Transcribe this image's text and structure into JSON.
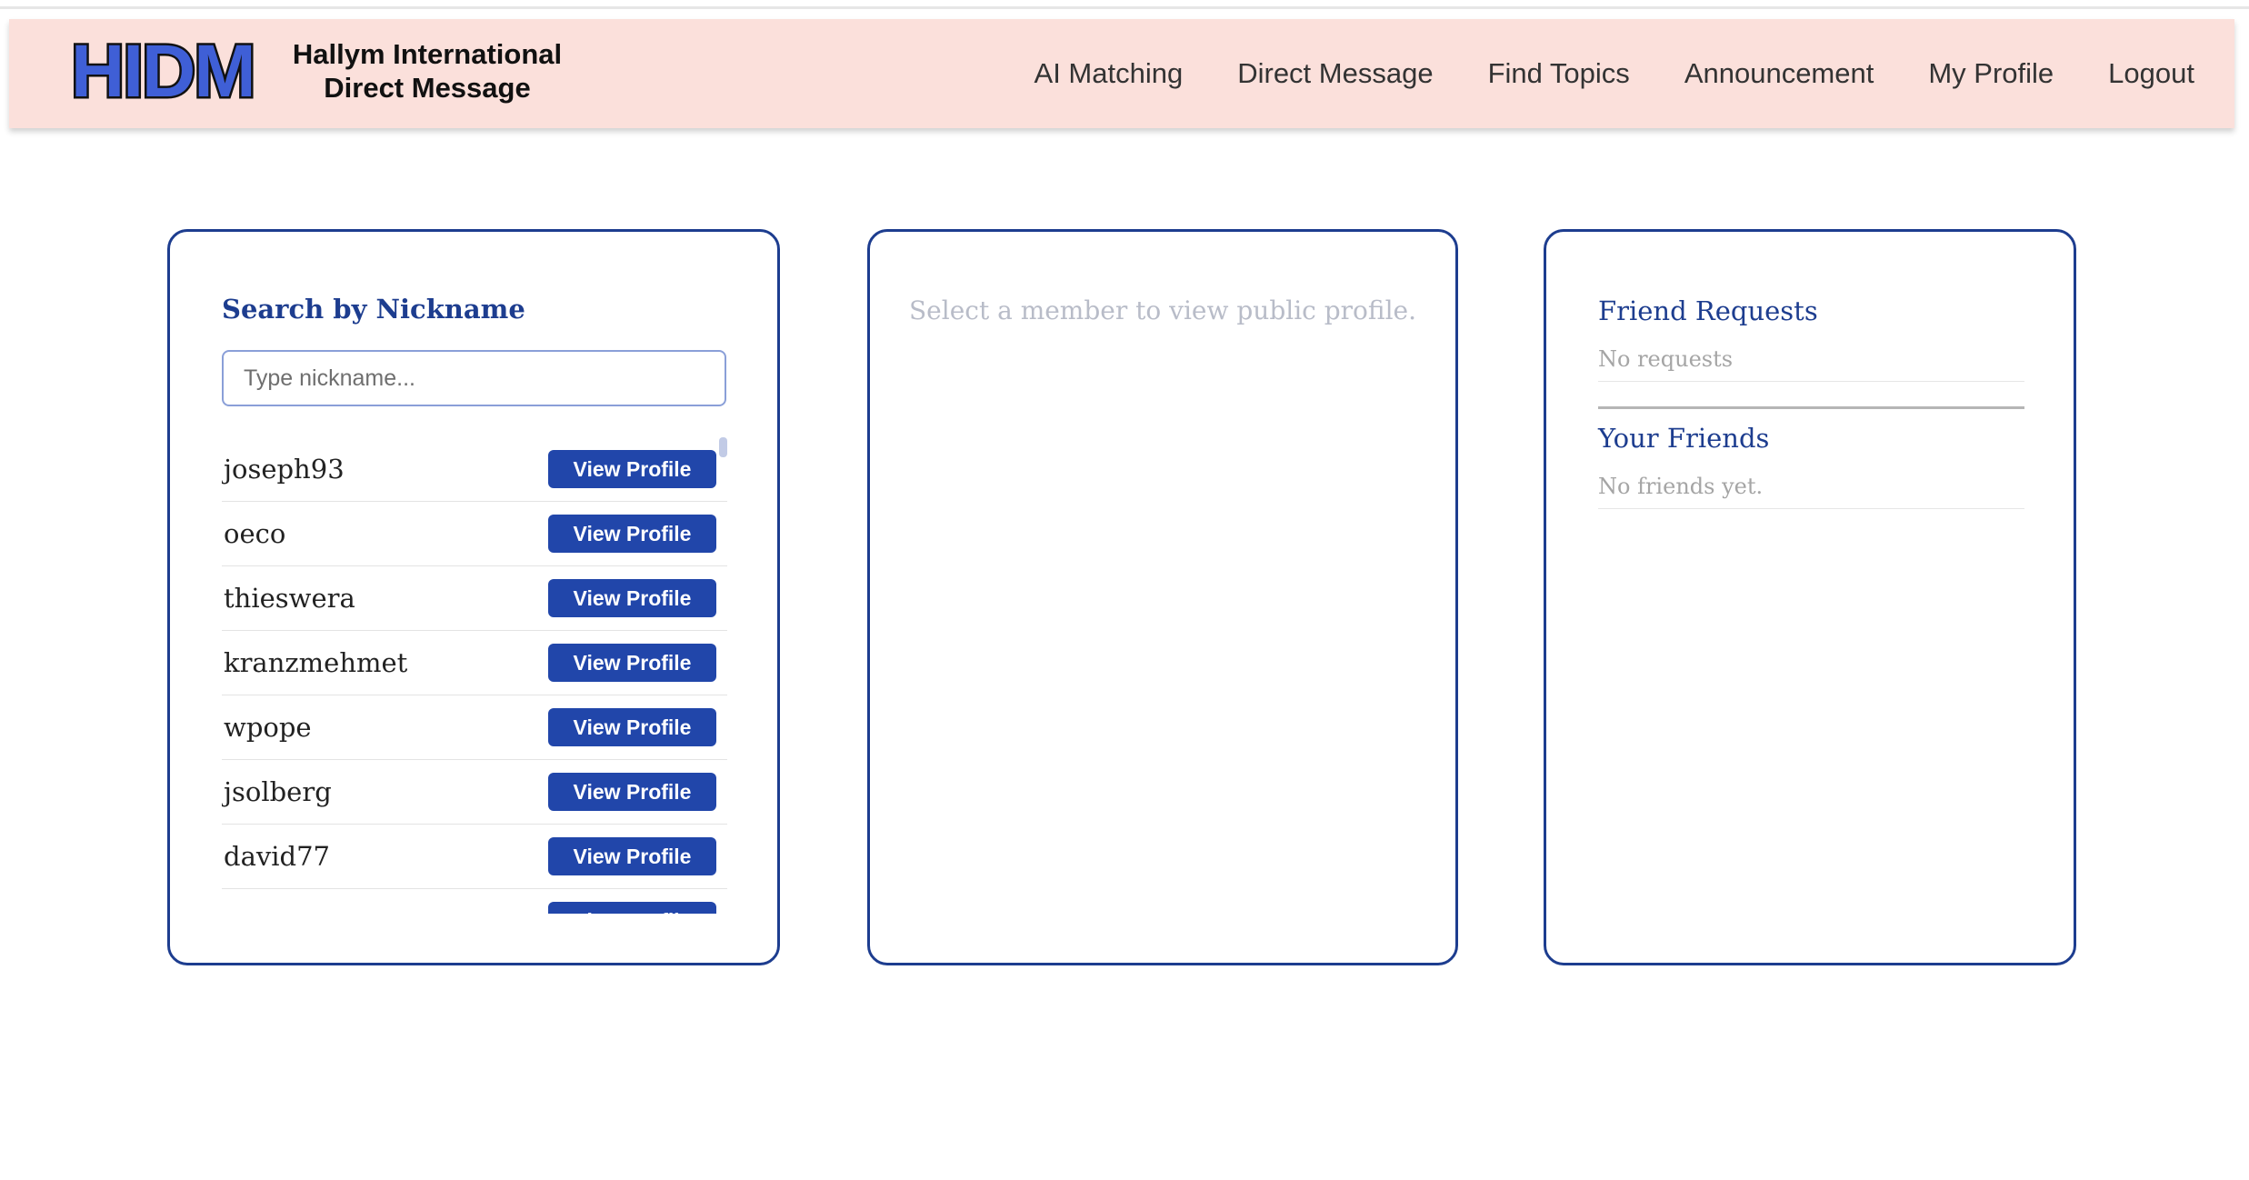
{
  "app": {
    "logo_text": "HIDM",
    "brand_line1": "Hallym International",
    "brand_line2": "Direct Message"
  },
  "nav": {
    "items": [
      {
        "label": "AI Matching"
      },
      {
        "label": "Direct Message"
      },
      {
        "label": "Find Topics"
      },
      {
        "label": "Announcement"
      },
      {
        "label": "My Profile"
      },
      {
        "label": "Logout"
      }
    ]
  },
  "search": {
    "heading": "Search by Nickname",
    "placeholder": "Type nickname...",
    "value": "",
    "button_label": "View Profile",
    "users": [
      {
        "nickname": "joseph93"
      },
      {
        "nickname": "oeco"
      },
      {
        "nickname": "thieswera"
      },
      {
        "nickname": "kranzmehmet"
      },
      {
        "nickname": "wpope"
      },
      {
        "nickname": "jsolberg"
      },
      {
        "nickname": "david77"
      },
      {
        "nickname": ""
      }
    ]
  },
  "profile": {
    "placeholder": "Select a member to view public profile."
  },
  "friends": {
    "requests_title": "Friend Requests",
    "requests_empty": "No requests",
    "friends_title": "Your Friends",
    "friends_empty": "No friends yet."
  },
  "colors": {
    "navbar_bg": "#fbe0db",
    "accent": "#1d3d8f",
    "button": "#2146aa",
    "logo_fill": "#3f5fd6"
  }
}
